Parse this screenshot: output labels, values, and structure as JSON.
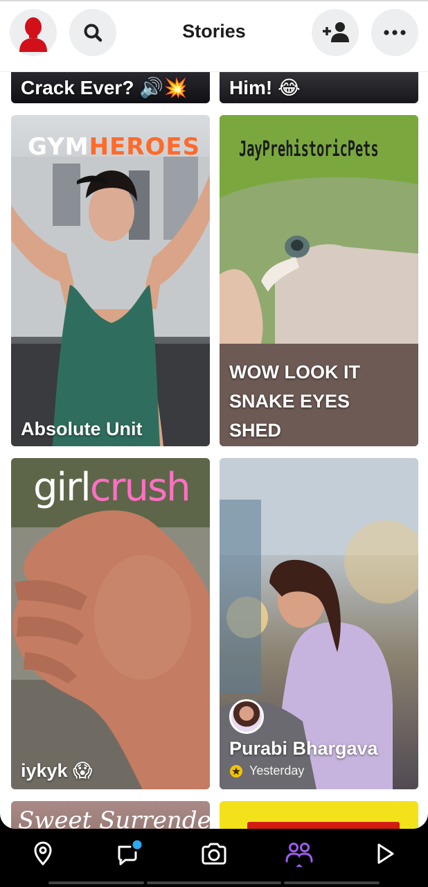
{
  "header": {
    "title": "Stories",
    "avatar_icon": "bitmoji-avatar-icon",
    "search_icon": "search-icon",
    "add_friend_icon": "add-friend-icon",
    "more_icon": "more-horizontal-icon"
  },
  "partial_top": {
    "left_caption": "Crack Ever? 🔊💥",
    "right_caption": "Him! 😂"
  },
  "stories": [
    {
      "brand": "GYMHEROES",
      "brand_part1": "GYM",
      "brand_part2": "HEROES",
      "caption": "Absolute Unit"
    },
    {
      "brand": "JayPrehistoricPets",
      "caption_lines": [
        "WOW LOOK IT",
        "SNAKE EYES",
        "SHED"
      ]
    },
    {
      "brand_part1": "girl",
      "brand_part2": "crush",
      "caption": "iykyk 😱"
    },
    {
      "name": "Purabi Bhargava",
      "time": "Yesterday"
    }
  ],
  "partial_bottom": {
    "left_text": "Sweet Surrender"
  },
  "nav": {
    "items": [
      "map-icon",
      "chat-icon",
      "camera-icon",
      "stories-icon",
      "spotlight-icon"
    ],
    "active": "stories-icon",
    "active_color": "#a05cf0",
    "chat_badge_color": "#2ea8f0"
  },
  "colors": {
    "gym_brand_orange": "#ff6a2a",
    "girlcrush_pink": "#ff6fc2",
    "yellow_star": "#f5c400"
  }
}
